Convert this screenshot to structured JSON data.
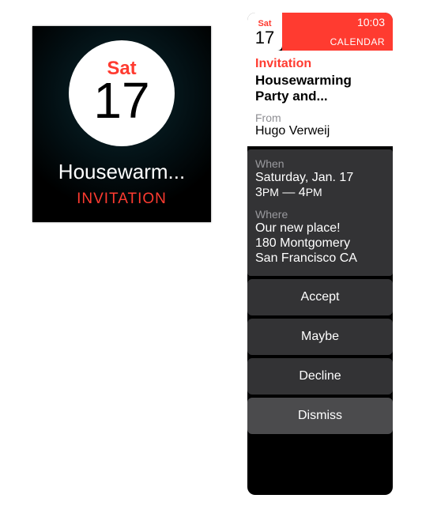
{
  "glance": {
    "day_abbrev": "Sat",
    "day_number": "17",
    "event_title_truncated": "Housewarm...",
    "subtitle": "INVITATION"
  },
  "detail": {
    "time": "10:03",
    "app_name": "CALENDAR",
    "date_badge": {
      "day_abbrev": "Sat",
      "day_number": "17"
    },
    "invitation_label": "Invitation",
    "event_title": "Housewarming Party and...",
    "from_label": "From",
    "from_name": "Hugo Verweij",
    "when_label": "When",
    "when_date": "Saturday, Jan. 17",
    "when_time_start": "3",
    "when_time_start_ampm": "PM",
    "when_time_sep": " — ",
    "when_time_end": "4",
    "when_time_end_ampm": "PM",
    "where_label": "Where",
    "where_line1": "Our new place!",
    "where_line2": "180 Montgomery",
    "where_line3": "San Francisco CA",
    "buttons": {
      "accept": "Accept",
      "maybe": "Maybe",
      "decline": "Decline",
      "dismiss": "Dismiss"
    }
  }
}
